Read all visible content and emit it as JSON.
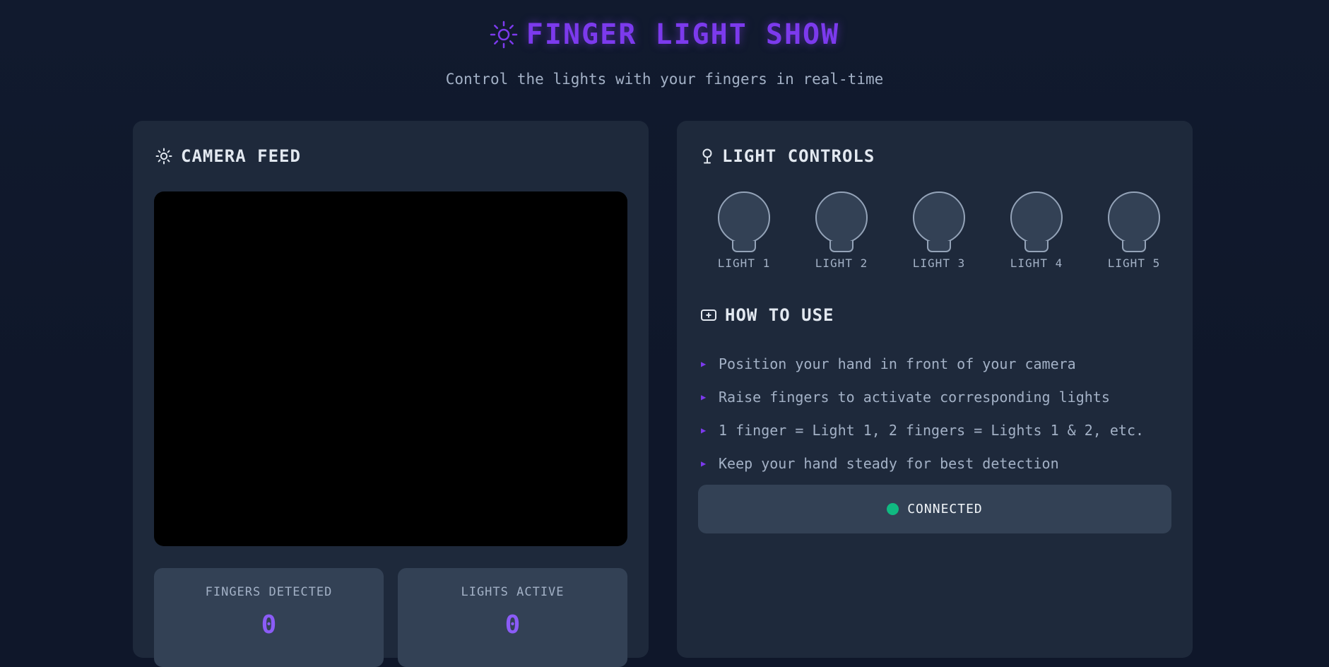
{
  "header": {
    "icon": "sun-icon",
    "title": "FINGER LIGHT SHOW",
    "subtitle": "Control the lights with your fingers in real-time"
  },
  "camera_panel": {
    "icon": "sun-icon",
    "heading": "CAMERA FEED",
    "stats": [
      {
        "label": "FINGERS DETECTED",
        "value": "0"
      },
      {
        "label": "LIGHTS ACTIVE",
        "value": "0"
      }
    ]
  },
  "controls_panel": {
    "icon": "lightbulb-icon",
    "heading": "LIGHT CONTROLS",
    "lights": [
      {
        "label": "LIGHT 1",
        "on": false
      },
      {
        "label": "LIGHT 2",
        "on": false
      },
      {
        "label": "LIGHT 3",
        "on": false
      },
      {
        "label": "LIGHT 4",
        "on": false
      },
      {
        "label": "LIGHT 5",
        "on": false
      }
    ]
  },
  "howto": {
    "icon": "info-card-icon",
    "heading": "HOW TO USE",
    "items": [
      "Position your hand in front of your camera",
      "Raise fingers to activate corresponding lights",
      "1 finger = Light 1, 2 fingers = Lights 1 & 2, etc.",
      "Keep your hand steady for best detection"
    ]
  },
  "status": {
    "text": "CONNECTED",
    "color": "#10b981"
  },
  "colors": {
    "accent": "#7c3aed",
    "background": "#0f172a",
    "panel": "#1e293b",
    "card": "#334155"
  }
}
